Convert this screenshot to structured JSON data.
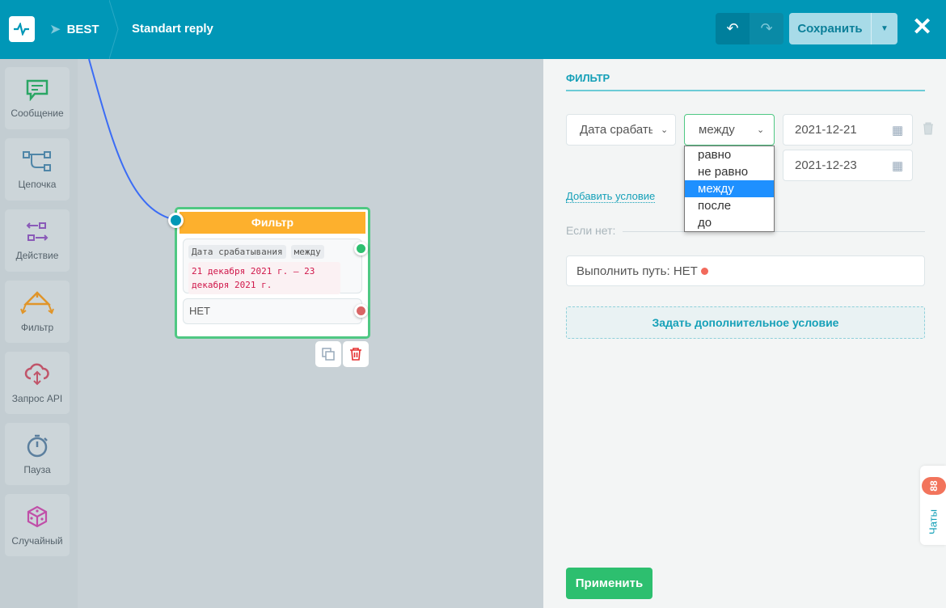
{
  "header": {
    "bot": "BEST",
    "title": "Standart reply",
    "save": "Сохранить"
  },
  "tools": [
    {
      "label": "Сообщение",
      "color": "#2aa664"
    },
    {
      "label": "Цепочка",
      "color": "#4f86a8"
    },
    {
      "label": "Действие",
      "color": "#8a5ab8"
    },
    {
      "label": "Фильтр",
      "color": "#e0952a"
    },
    {
      "label": "Запрос API",
      "color": "#c0556a"
    },
    {
      "label": "Пауза",
      "color": "#5b7f9e"
    },
    {
      "label": "Случайный",
      "color": "#c04fa8"
    }
  ],
  "node": {
    "title": "Фильтр",
    "field": "Дата срабатывания",
    "op": "между",
    "dates": "21 декабря 2021 г. — 23 декабря 2021 г.",
    "no": "НЕТ"
  },
  "panel": {
    "heading": "ФИЛЬТР",
    "field": "Дата срабать",
    "op": "между",
    "date1": "2021-12-21",
    "date2": "2021-12-23",
    "options": [
      "равно",
      "не равно",
      "между",
      "после",
      "до"
    ],
    "add": "Добавить условие",
    "if_no": "Если нет:",
    "path": "Выполнить путь: НЕТ",
    "extra": "Задать дополнительное условие",
    "apply": "Применить"
  },
  "chats": {
    "label": "Чаты",
    "count": "88"
  }
}
